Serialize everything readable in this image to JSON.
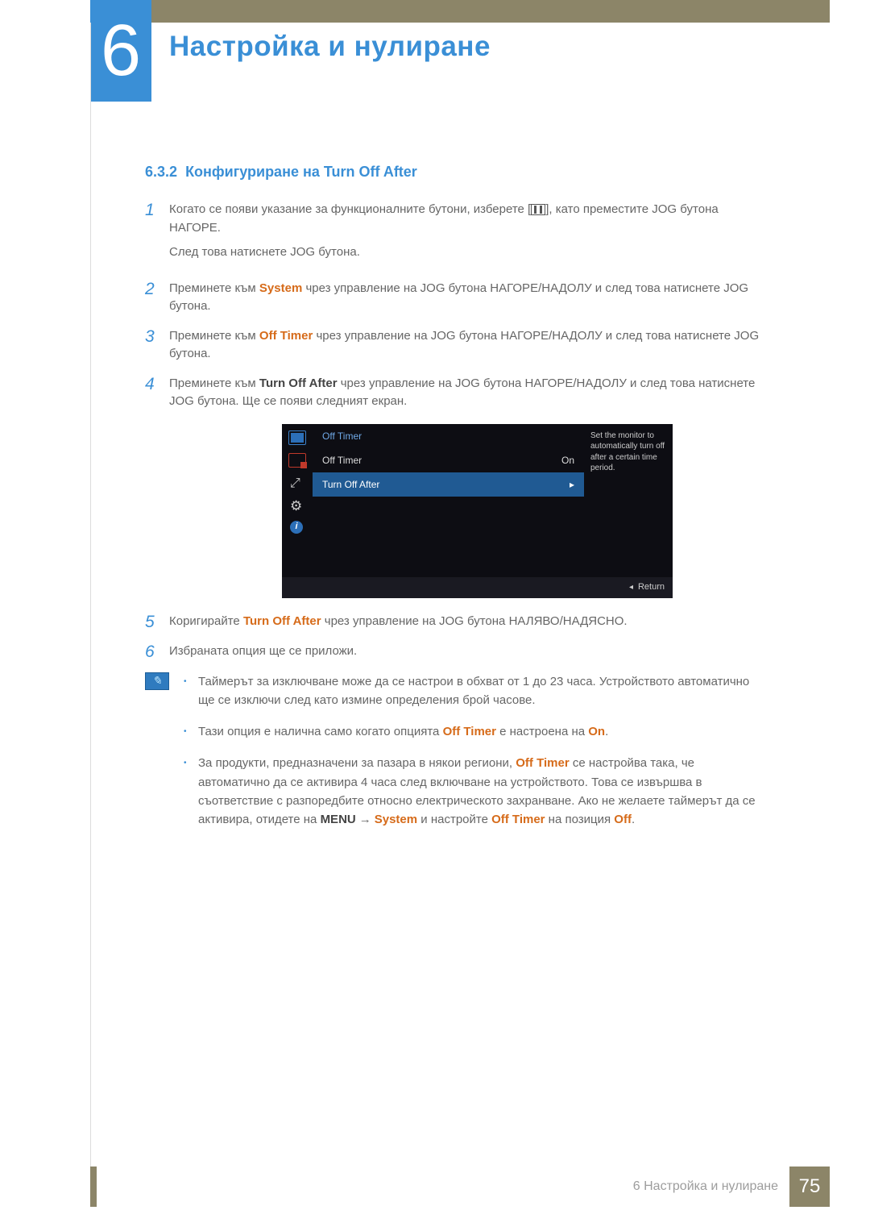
{
  "chapter": {
    "number": "6",
    "title": "Настройка и нулиране"
  },
  "section": {
    "number": "6.3.2",
    "title": "Конфигуриране на Turn Off After"
  },
  "steps": {
    "s1": {
      "num": "1",
      "p1a": "Когато се появи указание за функционалните бутони, изберете [",
      "p1b": "], като преместите JOG бутона НАГОРЕ.",
      "p2": "След това натиснете JOG бутона."
    },
    "s2": {
      "num": "2",
      "pre": "Преминете към ",
      "kw": "System",
      "post": " чрез управление на JOG бутона НАГОРЕ/НАДОЛУ и след това натиснете JOG бутона."
    },
    "s3": {
      "num": "3",
      "pre": "Преминете към ",
      "kw": "Off Timer",
      "post": " чрез управление на JOG бутона НАГОРЕ/НАДОЛУ и след това натиснете JOG бутона."
    },
    "s4": {
      "num": "4",
      "pre": "Преминете към ",
      "kw": "Turn Off After",
      "post": " чрез управление на JOG бутона НАГОРЕ/НАДОЛУ и след това натиснете JOG бутона. Ще се появи следният екран."
    },
    "s5": {
      "num": "5",
      "pre": "Коригирайте ",
      "kw": "Turn Off After",
      "post": " чрез управление на JOG бутона НАЛЯВО/НАДЯСНО."
    },
    "s6": {
      "num": "6",
      "text": "Избраната опция ще се приложи."
    }
  },
  "osd": {
    "header": "Off Timer",
    "row1_label": "Off Timer",
    "row1_value": "On",
    "row2_label": "Turn Off After",
    "tip": "Set the monitor to automatically turn off after a certain time period.",
    "return": "Return"
  },
  "notes": {
    "n1": "Таймерът за изключване може да се настрои в обхват от 1 до 23 часа. Устройството автоматично ще се изключи след като измине определения брой часове.",
    "n2_pre": "Тази опция е налична само когато опцията ",
    "n2_k1": "Off Timer",
    "n2_mid": " е настроена на ",
    "n2_k2": "On",
    "n2_post": ".",
    "n3_a": "За продукти, предназначени за пазара в някои региони, ",
    "n3_k1": "Off Timer",
    "n3_b": " се настройва така, че автоматично да се активира 4 часа след включване на устройството. Това се извършва в съответствие с разпоредбите относно електрическото захранване. Ако не желаете таймерът да се активира, отидете на ",
    "n3_k2": "MENU",
    "n3_arrow": "→",
    "n3_k3": "System",
    "n3_c": " и настройте ",
    "n3_k4": "Off Timer",
    "n3_d": " на позиция ",
    "n3_k5": "Off",
    "n3_e": "."
  },
  "footer": {
    "text": "6 Настройка и нулиране",
    "page": "75"
  }
}
